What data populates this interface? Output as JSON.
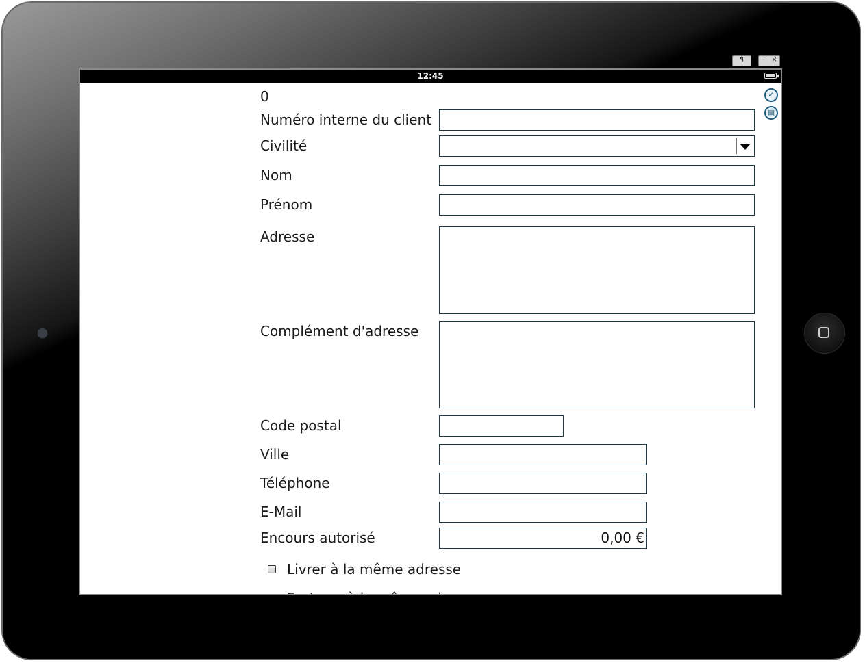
{
  "window": {
    "controls": {
      "back": "↰",
      "minimize": "–",
      "close": "×"
    }
  },
  "statusbar": {
    "time": "12:45"
  },
  "toolbar": {
    "check_icon": "check-circle-icon",
    "print_icon": "printer-icon"
  },
  "form": {
    "record_number": "0",
    "fields": {
      "client_internal_number": {
        "label": "Numéro interne du client",
        "value": ""
      },
      "civility": {
        "label": "Civilité",
        "value": ""
      },
      "last_name": {
        "label": "Nom",
        "value": ""
      },
      "first_name": {
        "label": "Prénom",
        "value": ""
      },
      "address": {
        "label": "Adresse",
        "value": ""
      },
      "address_complement": {
        "label": "Complément d'adresse",
        "value": ""
      },
      "postal_code": {
        "label": "Code postal",
        "value": ""
      },
      "city": {
        "label": "Ville",
        "value": ""
      },
      "phone": {
        "label": "Téléphone",
        "value": ""
      },
      "email": {
        "label": "E-Mail",
        "value": ""
      },
      "credit_limit": {
        "label": "Encours autorisé",
        "value": "0,00 €"
      }
    },
    "checkboxes": [
      {
        "label": "Livrer à la même adresse",
        "checked": false
      },
      {
        "label": "Facturer à la même adresse",
        "checked": false
      }
    ]
  },
  "colors": {
    "field_border": "#1e3a44",
    "icon_accent": "#1d5c7e",
    "frame": "#000000"
  }
}
